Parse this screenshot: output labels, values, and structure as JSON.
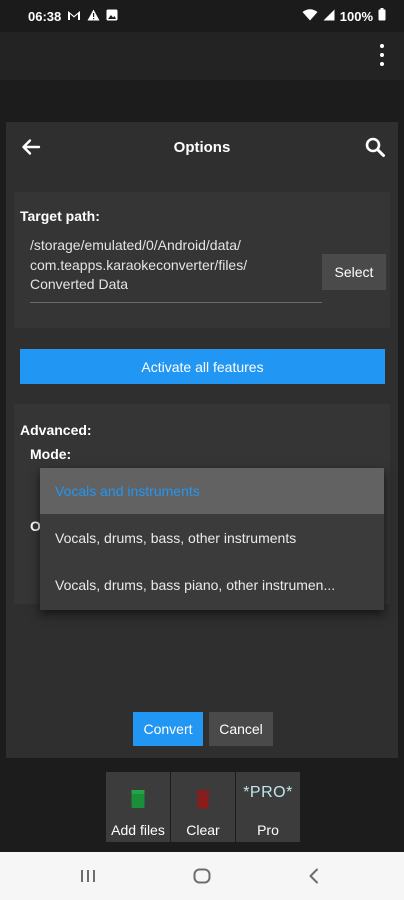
{
  "status_bar": {
    "time": "06:38",
    "battery": "100%",
    "left_icons": [
      "gmail-icon",
      "alert-icon",
      "image-icon"
    ],
    "right_icons": [
      "wifi-icon",
      "signal-icon",
      "battery-icon"
    ]
  },
  "app_bar": {
    "menu_icon": "overflow-menu-icon"
  },
  "dialog": {
    "title": "Options",
    "back_icon": "arrow-back-icon",
    "search_icon": "search-icon",
    "target_path": {
      "label": "Target path:",
      "value": "/storage/emulated/0/Android/data/ com.teapps.karaokeconverter/files/ Converted Data",
      "select_label": "Select"
    },
    "activate_label": "Activate all features",
    "advanced": {
      "label": "Advanced:",
      "mode_label": "Mode:",
      "partial_label": "O"
    },
    "mode_dropdown": {
      "options": [
        "Vocals and instruments",
        "Vocals, drums, bass, other instruments",
        "Vocals, drums, bass piano, other instrumen..."
      ],
      "selected_index": 0
    },
    "convert_label": "Convert",
    "cancel_label": "Cancel"
  },
  "toolbar": {
    "add_files_label": "Add files",
    "clear_label": "Clear",
    "pro_badge": "*PRO*",
    "pro_label": "Pro",
    "add_icon_color": "#1a8f3a",
    "clear_icon_color": "#8b1c1c"
  },
  "colors": {
    "accent": "#2196f3",
    "background": "#1e1e1e",
    "dialog": "#2f2f2f"
  }
}
